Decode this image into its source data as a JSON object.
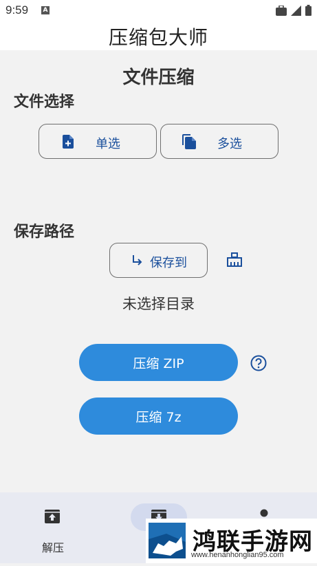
{
  "status_bar": {
    "time": "9:59",
    "notification_icon_label": "A",
    "icons": [
      "briefcase-icon",
      "signal-icon",
      "battery-icon"
    ]
  },
  "app": {
    "title": "压缩包大师"
  },
  "main": {
    "heading": "文件压缩",
    "file_section": {
      "label": "文件选择",
      "single_select_label": "单选",
      "multi_select_label": "多选"
    },
    "save_section": {
      "label": "保存路径",
      "save_to_label": "保存到",
      "directory_status": "未选择目录"
    },
    "compress_zip_label": "压缩 ZIP",
    "compress_7z_label": "压缩 7z"
  },
  "bottom_nav": {
    "items": [
      {
        "label": "解压",
        "icon": "archive-up-icon"
      },
      {
        "label": "",
        "icon": "archive-down-icon",
        "selected": true
      },
      {
        "label": "",
        "icon": "dot-icon"
      }
    ]
  },
  "watermark": {
    "title": "鸿联手游网",
    "url": "www.henanhonglian95.com"
  },
  "colors": {
    "accent": "#2e8bdc",
    "icon_blue": "#1a4f9c",
    "background": "#f2f2f2",
    "nav_background": "#e8eaf2"
  }
}
